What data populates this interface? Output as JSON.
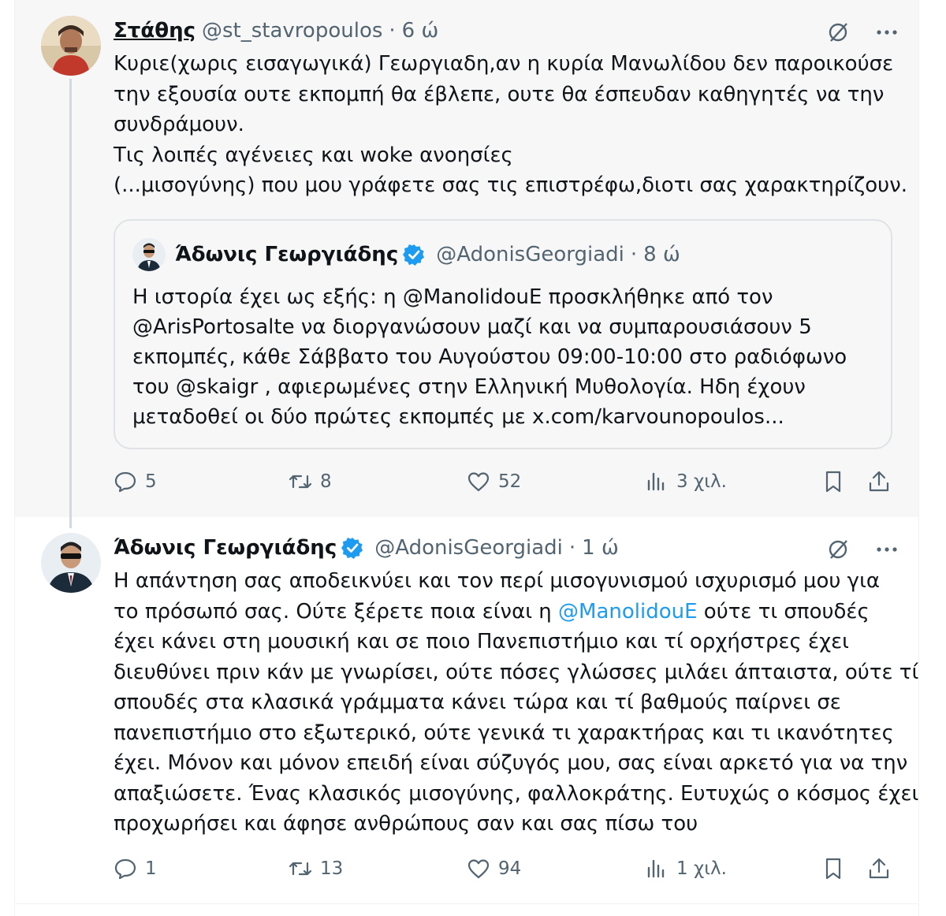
{
  "tweet1": {
    "name": "Στάθης",
    "handle": "@st_stavropoulos",
    "time": "6 ώ",
    "lines": [
      "Κυριε(χωρις εισαγωγικά) Γεωργιαδη,αν η κυρία  Μανωλίδου δεν παροικούσε",
      "την εξουσία ουτε εκπομπή θα έβλεπε, ουτε θα έσπευδαν καθηγητές να την",
      "συνδράμουν.",
      "Τις λοιπές αγένειες  και woke ανοησίες",
      "(...μισογύνης) που μου γράφετε σας τις επιστρέφω,διοτι σας χαρακτηρίζουν."
    ],
    "stats": {
      "replies": "5",
      "reposts": "8",
      "likes": "52",
      "views": "3 χιλ."
    }
  },
  "quote": {
    "name": "Άδωνις Γεωργιάδης",
    "handle": "@AdonisGeorgiadi",
    "time": "8 ώ",
    "lines": [
      "Η ιστορία έχει ως εξής: η @ManolidouE προσκλήθηκε από τον",
      "@ArisPortosalte να διοργανώσουν μαζί και να συμπαρουσιάσουν 5",
      "εκπομπές, κάθε Σάββατο του Αυγούστου 09:00-10:00 στο ραδιόφωνο",
      "του @skaigr , αφιερωμένες στην Ελληνική Μυθολογία. Ηδη έχουν",
      "μεταδοθεί οι δύο πρώτες εκπομπές με x.com/karvounopoulos..."
    ]
  },
  "tweet2": {
    "name": "Άδωνις Γεωργιάδης",
    "handle": "@AdonisGeorgiadi",
    "time": "1 ώ",
    "line1": "Η απάντηση σας αποδεικνύει και τον περί μισογυνισμού ισχυρισμό μου για",
    "line2_pre": "το πρόσωπό σας. Ούτε ξέρετε ποια είναι η ",
    "line2_mention": "@ManolidouE",
    "line2_post": " ούτε τι σπουδές",
    "lines_rest": [
      "έχει κάνει στη μουσική και σε ποιο Πανεπιστήμιο και τί ορχήστρες έχει",
      "διευθύνει πριν κάν με γνωρίσει, ούτε πόσες γλώσσες μιλάει άπταιστα, ούτε τί",
      "σπουδές στα κλασικά γράμματα κάνει τώρα και τί βαθμούς παίρνει σε",
      "πανεπιστήμιο στο εξωτερικό, ούτε γενικά τι χαρακτήρας και τι ικανότητες",
      "έχει. Μόνον και μόνον επειδή  είναι σύζυγός μου, σας είναι αρκετό για να την",
      "απαξιώσετε. Ένας κλασικός μισογύνης, φαλλοκράτης. Ευτυχώς ο κόσμος έχει",
      "προχωρήσει και άφησε ανθρώπους σαν και σας πίσω του"
    ],
    "stats": {
      "replies": "1",
      "reposts": "13",
      "likes": "94",
      "views": "1 χιλ."
    }
  },
  "colors": {
    "accent": "#1d9bf0",
    "muted": "#536471",
    "text": "#0f1419",
    "highlight_bg": "#f7f7f7"
  },
  "icons": [
    "reply-icon",
    "repost-icon",
    "like-icon",
    "views-icon",
    "bookmark-icon",
    "share-icon",
    "grok-icon",
    "more-icon",
    "verified-badge-icon"
  ]
}
